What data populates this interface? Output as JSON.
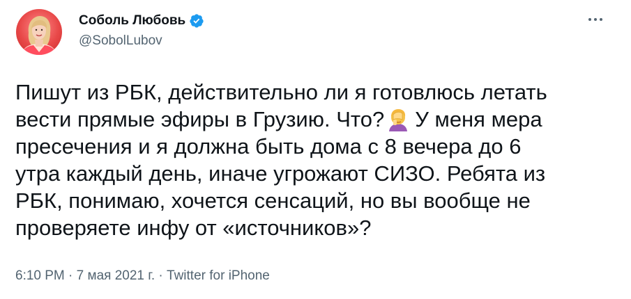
{
  "user": {
    "display_name": "Соболь Любовь",
    "handle": "@SobolLubov",
    "verified": true,
    "verified_icon": "verified-badge-icon",
    "verified_color": "#1d9bf0"
  },
  "more_icon": "more-horizontal-icon",
  "tweet": {
    "lines": [
      "Пишут из РБК, действительно ли я готовлюсь летать",
      "вести прямые эфиры в Грузию. Что?",
      "У меня мера",
      "пресечения и я должна быть дома с 8 вечера до 6",
      "утра каждый день, иначе угрожают СИЗО. Ребята из",
      "РБК, понимаю, хочется сенсаций, но вы вообще не",
      "проверяете инфу от «источников»?"
    ],
    "emoji": "person-facepalming-emoji"
  },
  "meta": {
    "time": "6:10 PM",
    "separator": "·",
    "date": "7 мая 2021 г.",
    "source": "Twitter for iPhone"
  },
  "colors": {
    "text": "#0f1419",
    "secondary": "#536471",
    "avatar_bg": "#e84848"
  }
}
